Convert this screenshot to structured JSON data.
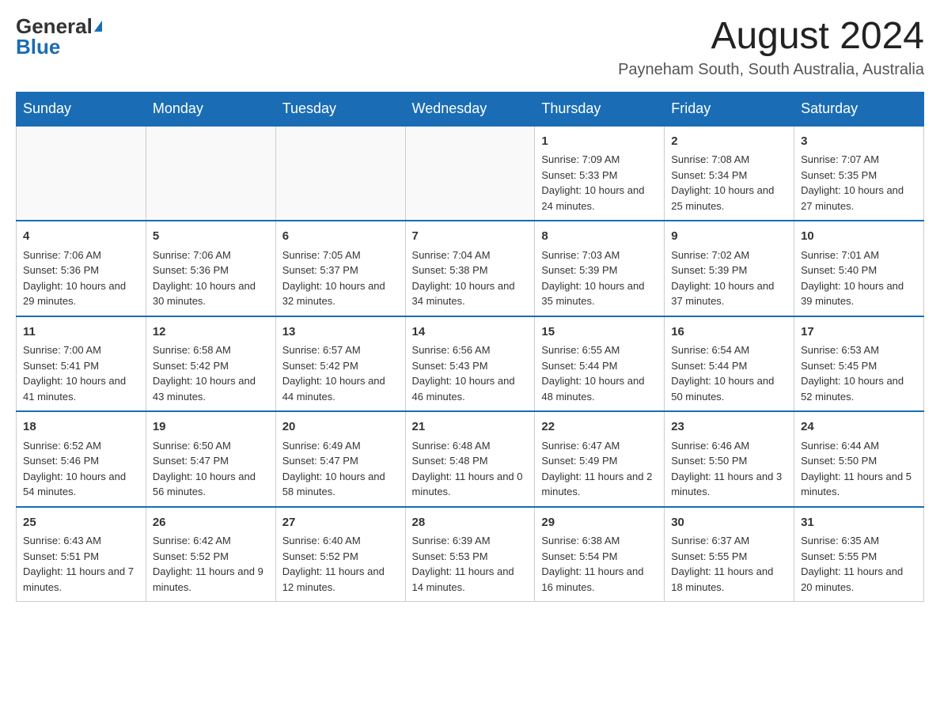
{
  "logo": {
    "general": "General",
    "blue": "Blue"
  },
  "title": "August 2024",
  "subtitle": "Payneham South, South Australia, Australia",
  "days_of_week": [
    "Sunday",
    "Monday",
    "Tuesday",
    "Wednesday",
    "Thursday",
    "Friday",
    "Saturday"
  ],
  "weeks": [
    [
      {
        "number": "",
        "info": ""
      },
      {
        "number": "",
        "info": ""
      },
      {
        "number": "",
        "info": ""
      },
      {
        "number": "",
        "info": ""
      },
      {
        "number": "1",
        "info": "Sunrise: 7:09 AM\nSunset: 5:33 PM\nDaylight: 10 hours and 24 minutes."
      },
      {
        "number": "2",
        "info": "Sunrise: 7:08 AM\nSunset: 5:34 PM\nDaylight: 10 hours and 25 minutes."
      },
      {
        "number": "3",
        "info": "Sunrise: 7:07 AM\nSunset: 5:35 PM\nDaylight: 10 hours and 27 minutes."
      }
    ],
    [
      {
        "number": "4",
        "info": "Sunrise: 7:06 AM\nSunset: 5:36 PM\nDaylight: 10 hours and 29 minutes."
      },
      {
        "number": "5",
        "info": "Sunrise: 7:06 AM\nSunset: 5:36 PM\nDaylight: 10 hours and 30 minutes."
      },
      {
        "number": "6",
        "info": "Sunrise: 7:05 AM\nSunset: 5:37 PM\nDaylight: 10 hours and 32 minutes."
      },
      {
        "number": "7",
        "info": "Sunrise: 7:04 AM\nSunset: 5:38 PM\nDaylight: 10 hours and 34 minutes."
      },
      {
        "number": "8",
        "info": "Sunrise: 7:03 AM\nSunset: 5:39 PM\nDaylight: 10 hours and 35 minutes."
      },
      {
        "number": "9",
        "info": "Sunrise: 7:02 AM\nSunset: 5:39 PM\nDaylight: 10 hours and 37 minutes."
      },
      {
        "number": "10",
        "info": "Sunrise: 7:01 AM\nSunset: 5:40 PM\nDaylight: 10 hours and 39 minutes."
      }
    ],
    [
      {
        "number": "11",
        "info": "Sunrise: 7:00 AM\nSunset: 5:41 PM\nDaylight: 10 hours and 41 minutes."
      },
      {
        "number": "12",
        "info": "Sunrise: 6:58 AM\nSunset: 5:42 PM\nDaylight: 10 hours and 43 minutes."
      },
      {
        "number": "13",
        "info": "Sunrise: 6:57 AM\nSunset: 5:42 PM\nDaylight: 10 hours and 44 minutes."
      },
      {
        "number": "14",
        "info": "Sunrise: 6:56 AM\nSunset: 5:43 PM\nDaylight: 10 hours and 46 minutes."
      },
      {
        "number": "15",
        "info": "Sunrise: 6:55 AM\nSunset: 5:44 PM\nDaylight: 10 hours and 48 minutes."
      },
      {
        "number": "16",
        "info": "Sunrise: 6:54 AM\nSunset: 5:44 PM\nDaylight: 10 hours and 50 minutes."
      },
      {
        "number": "17",
        "info": "Sunrise: 6:53 AM\nSunset: 5:45 PM\nDaylight: 10 hours and 52 minutes."
      }
    ],
    [
      {
        "number": "18",
        "info": "Sunrise: 6:52 AM\nSunset: 5:46 PM\nDaylight: 10 hours and 54 minutes."
      },
      {
        "number": "19",
        "info": "Sunrise: 6:50 AM\nSunset: 5:47 PM\nDaylight: 10 hours and 56 minutes."
      },
      {
        "number": "20",
        "info": "Sunrise: 6:49 AM\nSunset: 5:47 PM\nDaylight: 10 hours and 58 minutes."
      },
      {
        "number": "21",
        "info": "Sunrise: 6:48 AM\nSunset: 5:48 PM\nDaylight: 11 hours and 0 minutes."
      },
      {
        "number": "22",
        "info": "Sunrise: 6:47 AM\nSunset: 5:49 PM\nDaylight: 11 hours and 2 minutes."
      },
      {
        "number": "23",
        "info": "Sunrise: 6:46 AM\nSunset: 5:50 PM\nDaylight: 11 hours and 3 minutes."
      },
      {
        "number": "24",
        "info": "Sunrise: 6:44 AM\nSunset: 5:50 PM\nDaylight: 11 hours and 5 minutes."
      }
    ],
    [
      {
        "number": "25",
        "info": "Sunrise: 6:43 AM\nSunset: 5:51 PM\nDaylight: 11 hours and 7 minutes."
      },
      {
        "number": "26",
        "info": "Sunrise: 6:42 AM\nSunset: 5:52 PM\nDaylight: 11 hours and 9 minutes."
      },
      {
        "number": "27",
        "info": "Sunrise: 6:40 AM\nSunset: 5:52 PM\nDaylight: 11 hours and 12 minutes."
      },
      {
        "number": "28",
        "info": "Sunrise: 6:39 AM\nSunset: 5:53 PM\nDaylight: 11 hours and 14 minutes."
      },
      {
        "number": "29",
        "info": "Sunrise: 6:38 AM\nSunset: 5:54 PM\nDaylight: 11 hours and 16 minutes."
      },
      {
        "number": "30",
        "info": "Sunrise: 6:37 AM\nSunset: 5:55 PM\nDaylight: 11 hours and 18 minutes."
      },
      {
        "number": "31",
        "info": "Sunrise: 6:35 AM\nSunset: 5:55 PM\nDaylight: 11 hours and 20 minutes."
      }
    ]
  ]
}
